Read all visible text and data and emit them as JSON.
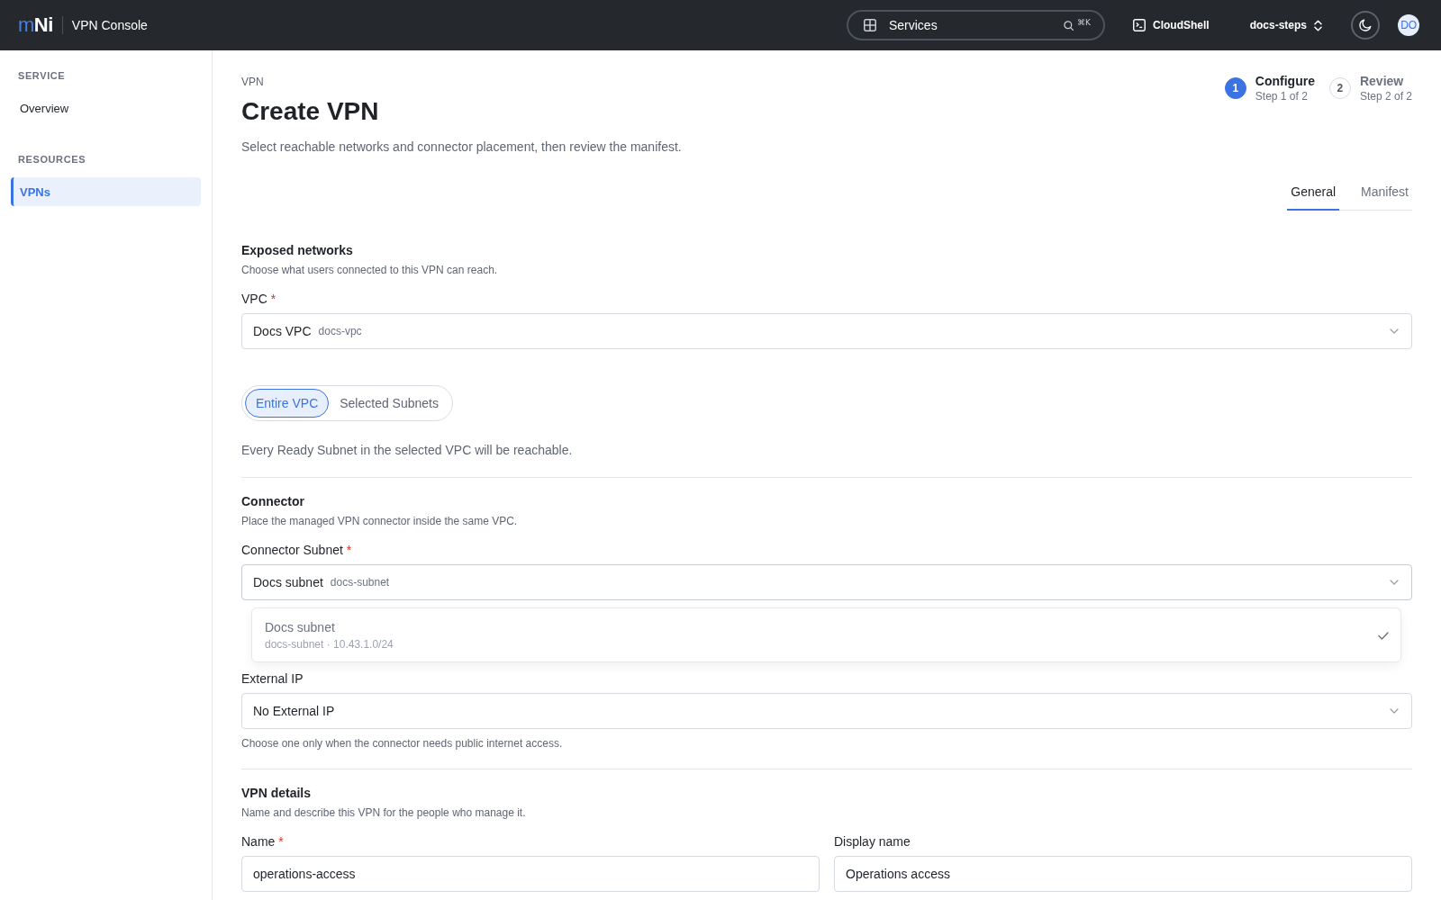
{
  "top_bar": {
    "logo": "m**Ni**",
    "app_name": "VPN Console",
    "services_search": {
      "label": "Services",
      "shortcut": "⌘K"
    },
    "cloudshell": "CloudShell",
    "project": "docs-steps",
    "avatar": "DO"
  },
  "sidebar": {
    "sections": [
      {
        "heading": "SERVICE",
        "items": [
          {
            "label": "Overview",
            "selected": false
          }
        ]
      },
      {
        "heading": "RESOURCES",
        "items": [
          {
            "label": "VPNs",
            "selected": true
          }
        ]
      }
    ]
  },
  "page": {
    "breadcrumb": "VPN",
    "title": "Create VPN",
    "subtitle": "Select reachable networks and connector placement, then review the manifest.",
    "steps": [
      {
        "number": "1",
        "title": "Configure",
        "caption": "Step 1 of 2",
        "active": true
      },
      {
        "number": "2",
        "title": "Review",
        "caption": "Step 2 of 2",
        "active": false
      }
    ],
    "tabs": [
      {
        "label": "General",
        "selected": true
      },
      {
        "label": "Manifest",
        "selected": false
      }
    ]
  },
  "sections": [
    {
      "title": "Exposed networks",
      "description": "Choose what users connected to this VPN can reach.",
      "fields": [
        {
          "kind": "select",
          "label": "VPC",
          "required_mark": "*",
          "value": "Docs VPC",
          "value_id": "docs-vpc",
          "expanded": false
        },
        {
          "kind": "segmented",
          "options": [
            {
              "label": "Entire VPC",
              "selected": true
            },
            {
              "label": "Selected Subnets",
              "selected": false
            }
          ],
          "note": "Every Ready Subnet in the selected VPC will be reachable."
        }
      ]
    },
    {
      "title": "Connector",
      "description": "Place the managed VPN connector inside the same VPC.",
      "fields": [
        {
          "kind": "select",
          "label": "Connector Subnet",
          "required_mark": "*",
          "value": "Docs subnet",
          "value_id": "docs-subnet",
          "expanded": true,
          "menu": {
            "options": [
              {
                "label": "Docs subnet",
                "detail": "docs-subnet · 10.43.1.0/24",
                "selected": true
              }
            ]
          }
        },
        {
          "kind": "select",
          "label": "External IP",
          "value": "No External IP",
          "expanded": false,
          "help": "Choose one only when the connector needs public internet access."
        }
      ]
    },
    {
      "title": "VPN details",
      "description": "Name and describe this VPN for the people who manage it.",
      "fields": [
        {
          "kind": "input_pair",
          "inputs": [
            {
              "label": "Name",
              "required_mark": "*",
              "value": "operations-access"
            },
            {
              "label": "Display name",
              "value": "Operations access"
            }
          ]
        }
      ]
    }
  ]
}
